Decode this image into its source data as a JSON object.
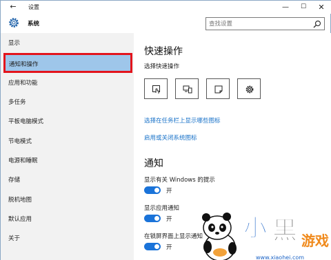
{
  "window": {
    "title": "设置"
  },
  "header": {
    "title": "系统"
  },
  "search": {
    "placeholder": "查找设置"
  },
  "sidebar": {
    "items": [
      {
        "label": "显示"
      },
      {
        "label": "通知和操作"
      },
      {
        "label": "应用和功能"
      },
      {
        "label": "多任务"
      },
      {
        "label": "平板电脑模式"
      },
      {
        "label": "节电模式"
      },
      {
        "label": "电源和睡眠"
      },
      {
        "label": "存储"
      },
      {
        "label": "脱机地图"
      },
      {
        "label": "默认应用"
      },
      {
        "label": "关于"
      }
    ]
  },
  "main": {
    "quick_actions": {
      "heading": "快速操作",
      "subheading": "选择快速操作",
      "buttons": [
        {
          "icon": "tablet-mode-icon"
        },
        {
          "icon": "connect-icon"
        },
        {
          "icon": "note-icon"
        },
        {
          "icon": "settings-icon"
        }
      ]
    },
    "links": {
      "taskbar_icons": "选择在任务栏上显示哪些图标",
      "system_icons": "启用或关闭系统图标"
    },
    "notifications": {
      "heading": "通知",
      "items": [
        {
          "label": "显示有关 Windows 的提示",
          "state": "开"
        },
        {
          "label": "显示应用通知",
          "state": "开"
        },
        {
          "label": "在锁屏界面上显示通知",
          "state": "开"
        }
      ]
    }
  },
  "watermark": {
    "title": "小黑游戏",
    "url": "www.xiaohei.com"
  },
  "colors": {
    "accent": "#1a73d9",
    "selection": "#9ec6ea",
    "highlight_border": "#e3141c",
    "link": "#1771c8"
  }
}
